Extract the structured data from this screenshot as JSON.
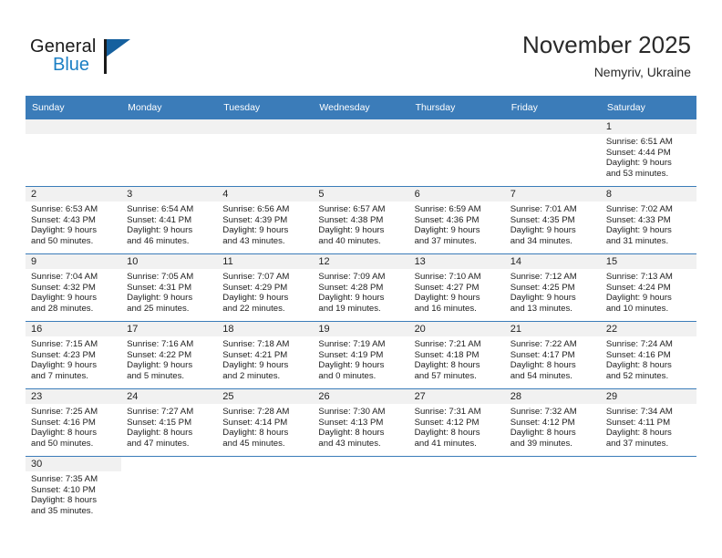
{
  "brand": {
    "name_part1": "General",
    "name_part2": "Blue"
  },
  "header": {
    "title": "November 2025",
    "subtitle": "Nemyriv, Ukraine"
  },
  "colors": {
    "header_blue": "#3b7cb9",
    "logo_blue": "#1b7fc4",
    "daynum_band": "#f1f1f1"
  },
  "weekday_headers": [
    "Sunday",
    "Monday",
    "Tuesday",
    "Wednesday",
    "Thursday",
    "Friday",
    "Saturday"
  ],
  "weeks": [
    [
      {
        "day": "",
        "sunrise": "",
        "sunset": "",
        "daylight1": "",
        "daylight2": "",
        "empty": true,
        "shaded": true
      },
      {
        "day": "",
        "sunrise": "",
        "sunset": "",
        "daylight1": "",
        "daylight2": "",
        "empty": true,
        "shaded": true
      },
      {
        "day": "",
        "sunrise": "",
        "sunset": "",
        "daylight1": "",
        "daylight2": "",
        "empty": true,
        "shaded": true
      },
      {
        "day": "",
        "sunrise": "",
        "sunset": "",
        "daylight1": "",
        "daylight2": "",
        "empty": true,
        "shaded": true
      },
      {
        "day": "",
        "sunrise": "",
        "sunset": "",
        "daylight1": "",
        "daylight2": "",
        "empty": true,
        "shaded": true
      },
      {
        "day": "",
        "sunrise": "",
        "sunset": "",
        "daylight1": "",
        "daylight2": "",
        "empty": true,
        "shaded": true
      },
      {
        "day": "1",
        "sunrise": "Sunrise: 6:51 AM",
        "sunset": "Sunset: 4:44 PM",
        "daylight1": "Daylight: 9 hours",
        "daylight2": "and 53 minutes.",
        "empty": false,
        "shaded": true
      }
    ],
    [
      {
        "day": "2",
        "sunrise": "Sunrise: 6:53 AM",
        "sunset": "Sunset: 4:43 PM",
        "daylight1": "Daylight: 9 hours",
        "daylight2": "and 50 minutes.",
        "empty": false,
        "shaded": true
      },
      {
        "day": "3",
        "sunrise": "Sunrise: 6:54 AM",
        "sunset": "Sunset: 4:41 PM",
        "daylight1": "Daylight: 9 hours",
        "daylight2": "and 46 minutes.",
        "empty": false,
        "shaded": true
      },
      {
        "day": "4",
        "sunrise": "Sunrise: 6:56 AM",
        "sunset": "Sunset: 4:39 PM",
        "daylight1": "Daylight: 9 hours",
        "daylight2": "and 43 minutes.",
        "empty": false,
        "shaded": true
      },
      {
        "day": "5",
        "sunrise": "Sunrise: 6:57 AM",
        "sunset": "Sunset: 4:38 PM",
        "daylight1": "Daylight: 9 hours",
        "daylight2": "and 40 minutes.",
        "empty": false,
        "shaded": true
      },
      {
        "day": "6",
        "sunrise": "Sunrise: 6:59 AM",
        "sunset": "Sunset: 4:36 PM",
        "daylight1": "Daylight: 9 hours",
        "daylight2": "and 37 minutes.",
        "empty": false,
        "shaded": true
      },
      {
        "day": "7",
        "sunrise": "Sunrise: 7:01 AM",
        "sunset": "Sunset: 4:35 PM",
        "daylight1": "Daylight: 9 hours",
        "daylight2": "and 34 minutes.",
        "empty": false,
        "shaded": true
      },
      {
        "day": "8",
        "sunrise": "Sunrise: 7:02 AM",
        "sunset": "Sunset: 4:33 PM",
        "daylight1": "Daylight: 9 hours",
        "daylight2": "and 31 minutes.",
        "empty": false,
        "shaded": true
      }
    ],
    [
      {
        "day": "9",
        "sunrise": "Sunrise: 7:04 AM",
        "sunset": "Sunset: 4:32 PM",
        "daylight1": "Daylight: 9 hours",
        "daylight2": "and 28 minutes.",
        "empty": false,
        "shaded": true
      },
      {
        "day": "10",
        "sunrise": "Sunrise: 7:05 AM",
        "sunset": "Sunset: 4:31 PM",
        "daylight1": "Daylight: 9 hours",
        "daylight2": "and 25 minutes.",
        "empty": false,
        "shaded": true
      },
      {
        "day": "11",
        "sunrise": "Sunrise: 7:07 AM",
        "sunset": "Sunset: 4:29 PM",
        "daylight1": "Daylight: 9 hours",
        "daylight2": "and 22 minutes.",
        "empty": false,
        "shaded": true
      },
      {
        "day": "12",
        "sunrise": "Sunrise: 7:09 AM",
        "sunset": "Sunset: 4:28 PM",
        "daylight1": "Daylight: 9 hours",
        "daylight2": "and 19 minutes.",
        "empty": false,
        "shaded": true
      },
      {
        "day": "13",
        "sunrise": "Sunrise: 7:10 AM",
        "sunset": "Sunset: 4:27 PM",
        "daylight1": "Daylight: 9 hours",
        "daylight2": "and 16 minutes.",
        "empty": false,
        "shaded": true
      },
      {
        "day": "14",
        "sunrise": "Sunrise: 7:12 AM",
        "sunset": "Sunset: 4:25 PM",
        "daylight1": "Daylight: 9 hours",
        "daylight2": "and 13 minutes.",
        "empty": false,
        "shaded": true
      },
      {
        "day": "15",
        "sunrise": "Sunrise: 7:13 AM",
        "sunset": "Sunset: 4:24 PM",
        "daylight1": "Daylight: 9 hours",
        "daylight2": "and 10 minutes.",
        "empty": false,
        "shaded": true
      }
    ],
    [
      {
        "day": "16",
        "sunrise": "Sunrise: 7:15 AM",
        "sunset": "Sunset: 4:23 PM",
        "daylight1": "Daylight: 9 hours",
        "daylight2": "and 7 minutes.",
        "empty": false,
        "shaded": true
      },
      {
        "day": "17",
        "sunrise": "Sunrise: 7:16 AM",
        "sunset": "Sunset: 4:22 PM",
        "daylight1": "Daylight: 9 hours",
        "daylight2": "and 5 minutes.",
        "empty": false,
        "shaded": true
      },
      {
        "day": "18",
        "sunrise": "Sunrise: 7:18 AM",
        "sunset": "Sunset: 4:21 PM",
        "daylight1": "Daylight: 9 hours",
        "daylight2": "and 2 minutes.",
        "empty": false,
        "shaded": true
      },
      {
        "day": "19",
        "sunrise": "Sunrise: 7:19 AM",
        "sunset": "Sunset: 4:19 PM",
        "daylight1": "Daylight: 9 hours",
        "daylight2": "and 0 minutes.",
        "empty": false,
        "shaded": true
      },
      {
        "day": "20",
        "sunrise": "Sunrise: 7:21 AM",
        "sunset": "Sunset: 4:18 PM",
        "daylight1": "Daylight: 8 hours",
        "daylight2": "and 57 minutes.",
        "empty": false,
        "shaded": true
      },
      {
        "day": "21",
        "sunrise": "Sunrise: 7:22 AM",
        "sunset": "Sunset: 4:17 PM",
        "daylight1": "Daylight: 8 hours",
        "daylight2": "and 54 minutes.",
        "empty": false,
        "shaded": true
      },
      {
        "day": "22",
        "sunrise": "Sunrise: 7:24 AM",
        "sunset": "Sunset: 4:16 PM",
        "daylight1": "Daylight: 8 hours",
        "daylight2": "and 52 minutes.",
        "empty": false,
        "shaded": true
      }
    ],
    [
      {
        "day": "23",
        "sunrise": "Sunrise: 7:25 AM",
        "sunset": "Sunset: 4:16 PM",
        "daylight1": "Daylight: 8 hours",
        "daylight2": "and 50 minutes.",
        "empty": false,
        "shaded": true
      },
      {
        "day": "24",
        "sunrise": "Sunrise: 7:27 AM",
        "sunset": "Sunset: 4:15 PM",
        "daylight1": "Daylight: 8 hours",
        "daylight2": "and 47 minutes.",
        "empty": false,
        "shaded": true
      },
      {
        "day": "25",
        "sunrise": "Sunrise: 7:28 AM",
        "sunset": "Sunset: 4:14 PM",
        "daylight1": "Daylight: 8 hours",
        "daylight2": "and 45 minutes.",
        "empty": false,
        "shaded": true
      },
      {
        "day": "26",
        "sunrise": "Sunrise: 7:30 AM",
        "sunset": "Sunset: 4:13 PM",
        "daylight1": "Daylight: 8 hours",
        "daylight2": "and 43 minutes.",
        "empty": false,
        "shaded": true
      },
      {
        "day": "27",
        "sunrise": "Sunrise: 7:31 AM",
        "sunset": "Sunset: 4:12 PM",
        "daylight1": "Daylight: 8 hours",
        "daylight2": "and 41 minutes.",
        "empty": false,
        "shaded": true
      },
      {
        "day": "28",
        "sunrise": "Sunrise: 7:32 AM",
        "sunset": "Sunset: 4:12 PM",
        "daylight1": "Daylight: 8 hours",
        "daylight2": "and 39 minutes.",
        "empty": false,
        "shaded": true
      },
      {
        "day": "29",
        "sunrise": "Sunrise: 7:34 AM",
        "sunset": "Sunset: 4:11 PM",
        "daylight1": "Daylight: 8 hours",
        "daylight2": "and 37 minutes.",
        "empty": false,
        "shaded": true
      }
    ],
    [
      {
        "day": "30",
        "sunrise": "Sunrise: 7:35 AM",
        "sunset": "Sunset: 4:10 PM",
        "daylight1": "Daylight: 8 hours",
        "daylight2": "and 35 minutes.",
        "empty": false,
        "shaded": true
      },
      {
        "day": "",
        "sunrise": "",
        "sunset": "",
        "daylight1": "",
        "daylight2": "",
        "empty": true,
        "shaded": false
      },
      {
        "day": "",
        "sunrise": "",
        "sunset": "",
        "daylight1": "",
        "daylight2": "",
        "empty": true,
        "shaded": false
      },
      {
        "day": "",
        "sunrise": "",
        "sunset": "",
        "daylight1": "",
        "daylight2": "",
        "empty": true,
        "shaded": false
      },
      {
        "day": "",
        "sunrise": "",
        "sunset": "",
        "daylight1": "",
        "daylight2": "",
        "empty": true,
        "shaded": false
      },
      {
        "day": "",
        "sunrise": "",
        "sunset": "",
        "daylight1": "",
        "daylight2": "",
        "empty": true,
        "shaded": false
      },
      {
        "day": "",
        "sunrise": "",
        "sunset": "",
        "daylight1": "",
        "daylight2": "",
        "empty": true,
        "shaded": false
      }
    ]
  ]
}
